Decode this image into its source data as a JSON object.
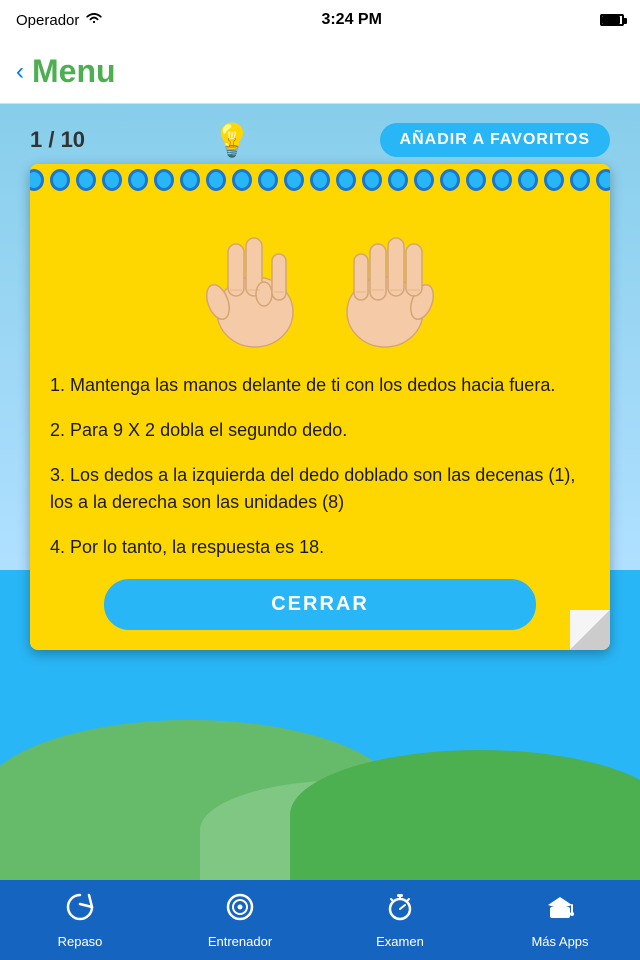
{
  "statusBar": {
    "carrier": "Operador",
    "time": "3:24 PM",
    "wifi": true,
    "battery": 100
  },
  "navBar": {
    "backLabel": "Menu",
    "title": "Menu"
  },
  "topBar": {
    "progress": "1 / 10",
    "addFavoritesLabel": "AÑADIR A FAVORITOS"
  },
  "card": {
    "instructions": [
      "1. Mantenga las manos delante de ti con los dedos hacia fuera.",
      "2. Para 9 X 2 dobla el segundo dedo.",
      "3. Los dedos a la izquierda del dedo doblado son las decenas (1), los a la derecha son las unidades (8)",
      "4. Por lo tanto, la respuesta es 18."
    ],
    "closeLabel": "CERRAR"
  },
  "tabBar": {
    "items": [
      {
        "id": "repaso",
        "label": "Repaso",
        "icon": "refresh"
      },
      {
        "id": "entrenador",
        "label": "Entrenador",
        "icon": "target"
      },
      {
        "id": "examen",
        "label": "Examen",
        "icon": "timer"
      },
      {
        "id": "mas-apps",
        "label": "Más Apps",
        "icon": "graduation"
      }
    ]
  }
}
